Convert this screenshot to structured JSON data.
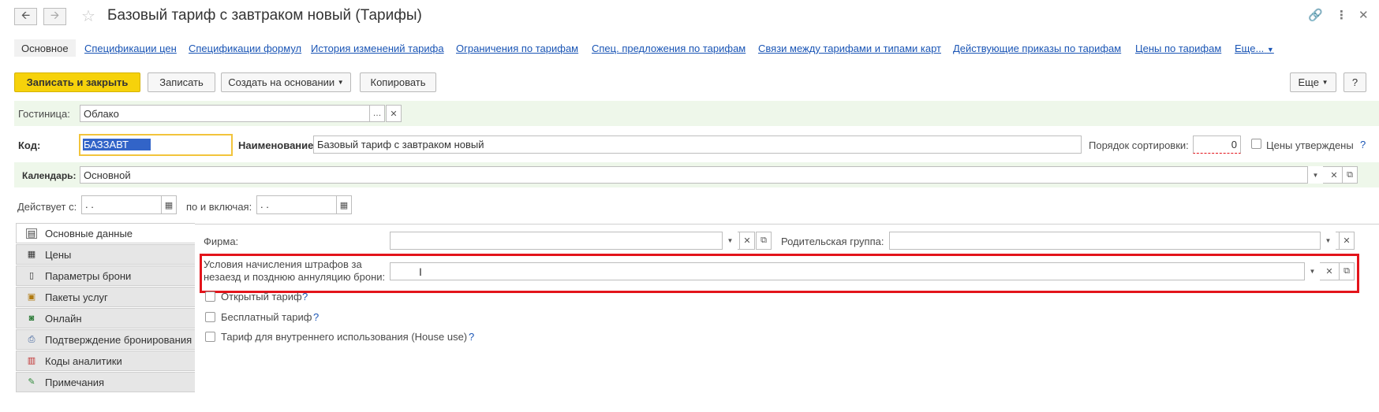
{
  "window": {
    "title": "Базовый тариф с завтраком новый (Тарифы)",
    "back_icon": "arrow-left-icon",
    "forward_icon": "arrow-right-icon",
    "favorite_icon": "star-icon",
    "link_icon": "link-icon",
    "more_icon": "kebab-icon",
    "close_icon": "close-icon"
  },
  "nav": {
    "current": "Основное",
    "links": [
      "Спецификации цен",
      "Спецификации формул",
      "История изменений тарифа",
      "Ограничения по тарифам",
      "Спец. предложения по тарифам",
      "Связи между тарифами и типами карт",
      "Действующие приказы по тарифам",
      "Цены по тарифам",
      "Еще..."
    ]
  },
  "toolbar": {
    "save_close": "Записать и закрыть",
    "save": "Записать",
    "create_based": "Создать на основании",
    "copy": "Копировать",
    "more": "Еще",
    "help": "?"
  },
  "hotel": {
    "label": "Гостиница:",
    "value": "Облако"
  },
  "code": {
    "label": "Код:",
    "value": "БАЗЗАВТ"
  },
  "name": {
    "label": "Наименование:",
    "value": "Базовый тариф с завтраком новый"
  },
  "sort": {
    "label": "Порядок сортировки:",
    "value": "0"
  },
  "prices_approved": {
    "label": "Цены утверждены",
    "help": "?"
  },
  "calendar": {
    "label": "Календарь:",
    "value": "Основной"
  },
  "valid_from": {
    "label": "Действует с:",
    "value": ". ."
  },
  "valid_to": {
    "label": "по и включая:",
    "value": ". ."
  },
  "side_tabs": [
    {
      "label": "Основные данные",
      "icon": "table-icon"
    },
    {
      "label": "Цены",
      "icon": "grid-icon"
    },
    {
      "label": "Параметры брони",
      "icon": "document-icon"
    },
    {
      "label": "Пакеты услуг",
      "icon": "package-icon"
    },
    {
      "label": "Онлайн",
      "icon": "globe-icon"
    },
    {
      "label": "Подтверждение бронирования",
      "icon": "printer-icon"
    },
    {
      "label": "Коды аналитики",
      "icon": "chart-icon"
    },
    {
      "label": "Примечания",
      "icon": "pencil-icon"
    }
  ],
  "firm": {
    "label": "Фирма:",
    "value": ""
  },
  "parent_group": {
    "label": "Родительская группа:",
    "value": ""
  },
  "penalty": {
    "label_line1": "Условия начисления штрафов за",
    "label_line2": "незаезд и позднюю аннуляцию брони:",
    "value": ""
  },
  "checkboxes": [
    {
      "label": "Открытый тариф",
      "help": "?"
    },
    {
      "label": "Бесплатный тариф",
      "help": "?"
    },
    {
      "label": "Тариф для внутреннего использования (House use)",
      "help": "?"
    }
  ],
  "colors": {
    "accent_yellow": "#f6d20b",
    "link_blue": "#1a55b5",
    "highlight_red": "#e3141b",
    "band_green": "#eef7ea"
  }
}
